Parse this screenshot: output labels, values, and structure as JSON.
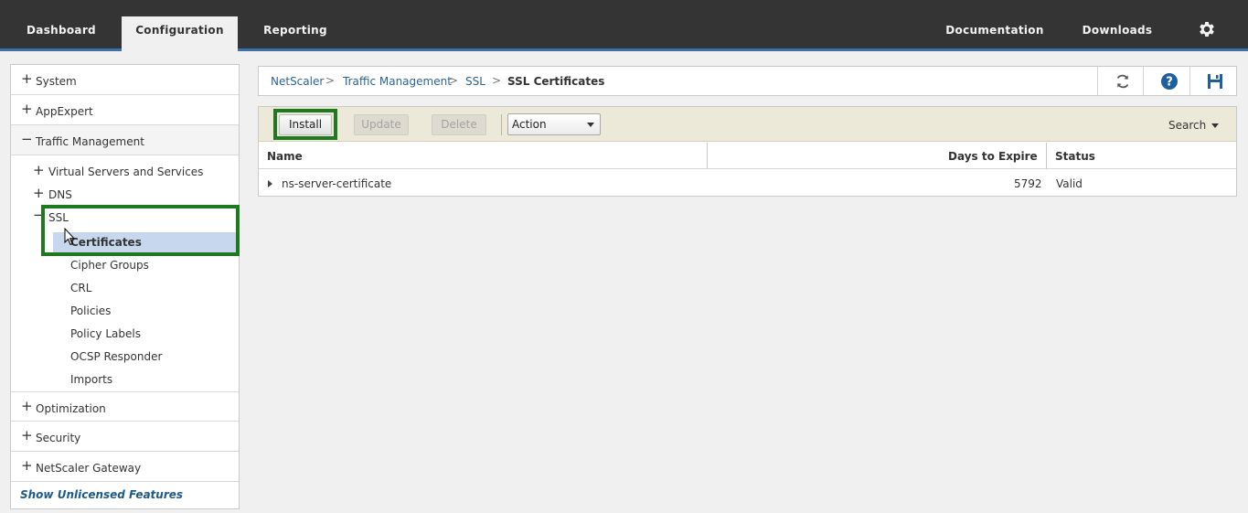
{
  "top_nav": {
    "tabs": [
      {
        "label": "Dashboard",
        "active": false
      },
      {
        "label": "Configuration",
        "active": true
      },
      {
        "label": "Reporting",
        "active": false
      }
    ],
    "right_links": [
      "Documentation",
      "Downloads"
    ],
    "settings_icon": "gear-icon"
  },
  "sidebar": {
    "items": [
      {
        "label": "System",
        "state": "+"
      },
      {
        "label": "AppExpert",
        "state": "+"
      },
      {
        "label": "Traffic Management",
        "state": "−"
      }
    ],
    "traffic_children": [
      {
        "label": "Virtual Servers and Services",
        "state": "+"
      },
      {
        "label": "DNS",
        "state": "+"
      },
      {
        "label": "SSL",
        "state": "−"
      }
    ],
    "ssl_children": [
      "Certificates",
      "Cipher Groups",
      "CRL",
      "Policies",
      "Policy Labels",
      "OCSP Responder",
      "Imports"
    ],
    "bottom_items": [
      {
        "label": "Optimization",
        "state": "+"
      },
      {
        "label": "Security",
        "state": "+"
      },
      {
        "label": "NetScaler Gateway",
        "state": "+"
      }
    ],
    "footer_link": "Show Unlicensed Features"
  },
  "breadcrumb": {
    "items": [
      "NetScaler",
      "Traffic Management",
      "SSL"
    ],
    "current": "SSL Certificates",
    "separator": ">"
  },
  "toolbar": {
    "install_label": "Install",
    "update_label": "Update",
    "delete_label": "Delete",
    "action_select": "Action",
    "search_label": "Search"
  },
  "table": {
    "columns": [
      "Name",
      "Days to Expire",
      "Status"
    ],
    "rows": [
      {
        "name": "ns-server-certificate",
        "days": "5792",
        "status": "Valid"
      }
    ]
  },
  "colors": {
    "topbar_bg": "#343434",
    "accent": "#3a6fa8",
    "highlight_green": "#1f7a1f",
    "selected_row": "#c6d7ee",
    "link_blue": "#2a6496"
  }
}
